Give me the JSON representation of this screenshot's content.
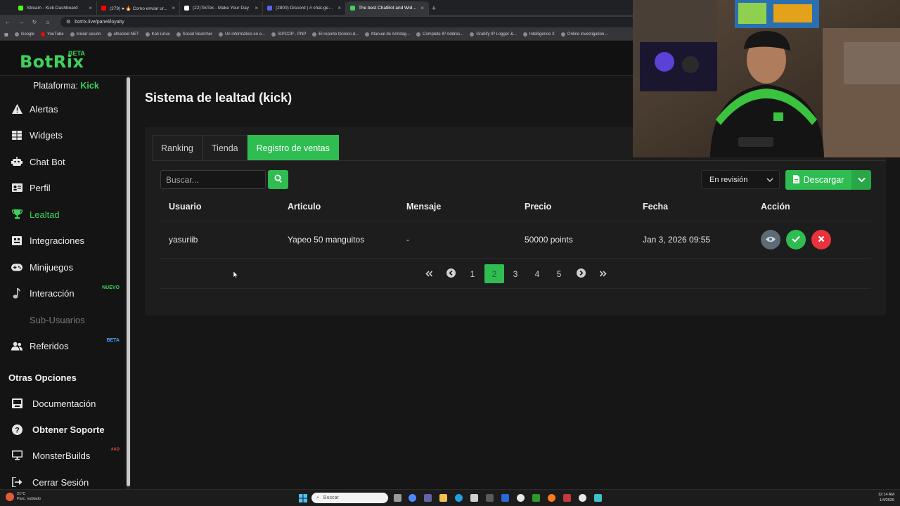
{
  "browser": {
    "tabs": [
      {
        "title": "Stream - Kick Dashboard",
        "color": "#53fc18"
      },
      {
        "title": "(279) ● 🔥 Como enviar ur...",
        "color": "#ff0000"
      },
      {
        "title": "(22)TikTok - Make Your Day",
        "color": "#ffffff"
      },
      {
        "title": "(2800) Discord | # chat-gene...",
        "color": "#5865f2"
      },
      {
        "title": "The best ChatBot and Widgets...",
        "color": "#3fd15c"
      }
    ],
    "url": "botrix.live/panel/loyalty",
    "bookmarks": [
      "Google",
      "YouTube",
      "Iniciar sesión",
      "elhacker.NET",
      "Kali Linux",
      "Social Searcher",
      "Un informático en e...",
      "SIPCOP - PNP",
      "El reporte técnico d...",
      "Manual de Armitag...",
      "Complete IP Addres...",
      "Grabify IP Logger &...",
      "Intelligence X",
      "Online investigation..."
    ]
  },
  "app": {
    "logo": "BotRix",
    "logo_badge": "BETA"
  },
  "sidebar": {
    "platform_label": "Plataforma:",
    "platform_value": "Kick",
    "items": [
      {
        "label": "Alertas",
        "icon": "warning-icon"
      },
      {
        "label": "Widgets",
        "icon": "grid-icon"
      },
      {
        "label": "Chat Bot",
        "icon": "robot-icon"
      },
      {
        "label": "Perfil",
        "icon": "id-card-icon"
      },
      {
        "label": "Lealtad",
        "icon": "trophy-icon"
      },
      {
        "label": "Integraciones",
        "icon": "plug-icon"
      },
      {
        "label": "Minijuegos",
        "icon": "gamepad-icon"
      },
      {
        "label": "Interacción",
        "icon": "music-icon",
        "badge": "NUEVO"
      },
      {
        "label": "Sub-Usuarios",
        "icon": "users-icon"
      },
      {
        "label": "Referidos",
        "icon": "user-group-icon",
        "badge": "BETA"
      }
    ],
    "other_heading": "Otras Opciones",
    "other_items": [
      {
        "label": "Documentación",
        "icon": "book-icon"
      },
      {
        "label": "Obtener Soporte",
        "icon": "question-icon"
      },
      {
        "label": "MonsterBuilds",
        "icon": "monitor-icon",
        "badge": "#AD"
      },
      {
        "label": "Cerrar Sesión",
        "icon": "logout-icon"
      }
    ]
  },
  "main": {
    "title": "Sistema de lealtad (kick)",
    "tabs": [
      "Ranking",
      "Tienda",
      "Registro de ventas"
    ],
    "active_tab": 2,
    "search_placeholder": "Buscar...",
    "filter_value": "En revisión",
    "download_label": "Descargar",
    "columns": [
      "Usuario",
      "Articulo",
      "Mensaje",
      "Precio",
      "Fecha",
      "Acción"
    ],
    "rows": [
      {
        "usuario": "yasuriib",
        "articulo": "Yapeo 50 manguitos",
        "mensaje": "-",
        "precio": "50000 points",
        "fecha": "Jan 3, 2026 09:55"
      }
    ],
    "pagination": {
      "pages": [
        "1",
        "2",
        "3",
        "4",
        "5"
      ],
      "current": "2"
    }
  },
  "taskbar": {
    "weather_temp": "21°C",
    "weather_desc": "Parc. nublado",
    "search_placeholder": "Buscar",
    "time": "12:14 AM",
    "date": "1/4/2026"
  },
  "colors": {
    "accent": "#2fbd52",
    "danger": "#e8323c",
    "view_button": "#5c6b75"
  }
}
